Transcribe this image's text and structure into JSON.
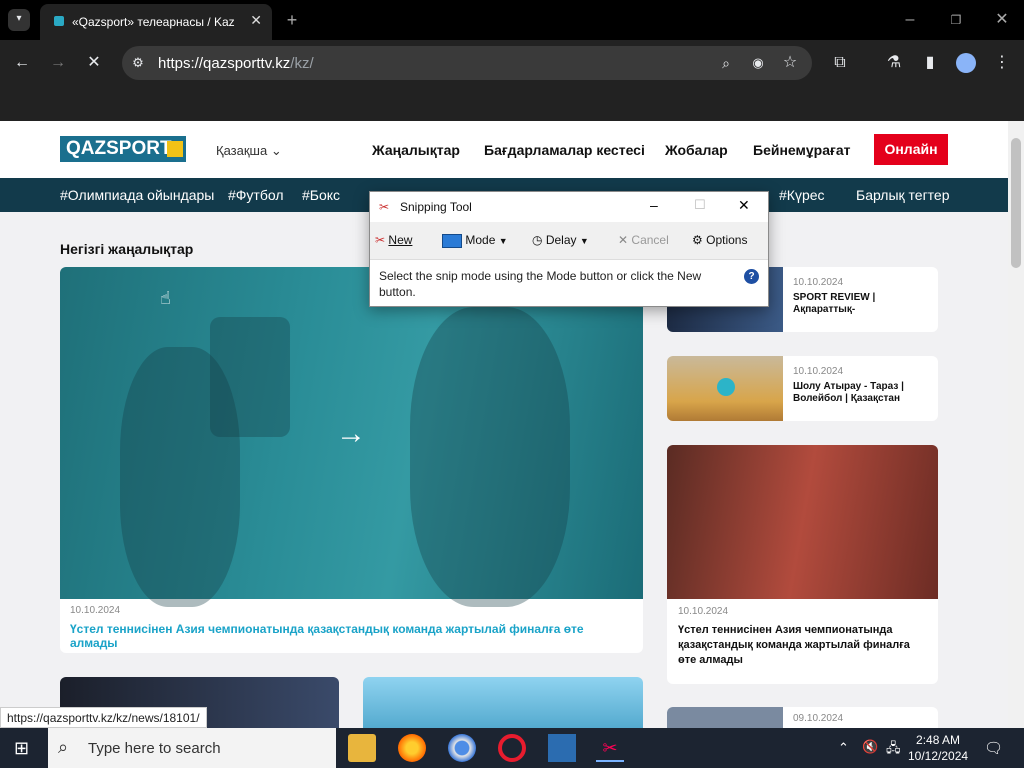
{
  "browser": {
    "tab_title": "«Qazsport» телеарнасы / Kaz",
    "url_host": "https://qazsporttv.kz",
    "url_path": "/kz/"
  },
  "site": {
    "logo_text": "QAZSPORT",
    "language": "Қазақша",
    "nav": [
      "Жаңалықтар",
      "Бағдарламалар кестесі",
      "Жобалар",
      "Бейнемұрағат"
    ],
    "online_button": "Онлайн",
    "tags": [
      "#Олимпиада ойындары",
      "#Футбол",
      "#Бокс",
      "#Күрес",
      "Барлық тегтер"
    ]
  },
  "section_title": "Негізгі жаңалықтар",
  "main_article": {
    "arrow": "→",
    "date": "10.10.2024",
    "title": "Үстел теннисінен Азия чемпионатында қазақстандық команда жартылай финалға өте алмады"
  },
  "side_articles": [
    {
      "date": "10.10.2024",
      "title": "SPORT REVIEW | Ақпараттық-"
    },
    {
      "date": "10.10.2024",
      "title": "Шолу Атырау - Тараз | Волейбол | Қазақстан"
    }
  ],
  "big_side": {
    "date": "10.10.2024",
    "title": "Үстел теннисінен Азия чемпионатында қазақстандық команда жартылай финалға өте алмады"
  },
  "bottom_side_date": "09.10.2024",
  "status_url": "https://qazsporttv.kz/kz/news/18101/",
  "snipping_tool": {
    "title": "Snipping Tool",
    "new": "New",
    "mode": "Mode",
    "delay": "Delay",
    "cancel": "Cancel",
    "options": "Options",
    "message": "Select the snip mode using the Mode button or click the New button."
  },
  "taskbar": {
    "search_placeholder": "Type here to search",
    "time": "2:48 AM",
    "date": "10/12/2024"
  }
}
